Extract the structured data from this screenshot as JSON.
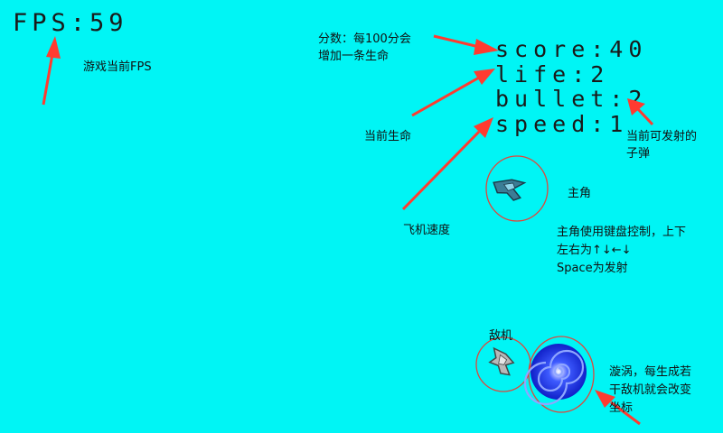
{
  "hud": {
    "fps": "FPS:59",
    "score": "score:40",
    "life": "life:2",
    "bullet": "bullet:2",
    "speed": "speed:1"
  },
  "annotations": {
    "fps_note": "游戏当前FPS",
    "score_note_line1": "分数：每100分会",
    "score_note_line2": "增加一条生命",
    "life_note": "当前生命",
    "bullet_note_line1": "当前可发射的",
    "bullet_note_line2": "子弹",
    "speed_note": "飞机速度",
    "player_note": "主角",
    "controls_line1": "主角使用键盘控制，上下",
    "controls_line2": "左右为↑↓←↓",
    "controls_line3": "Space为发射",
    "enemy_note": "敌机",
    "vortex_line1": "漩涡，每生成若",
    "vortex_line2": "干敌机就会改变",
    "vortex_line3": "坐标"
  },
  "colors": {
    "background": "#00f5f5",
    "arrow": "#ff3b30",
    "circle": "#e0463c",
    "vortex": "#1d2bff"
  }
}
